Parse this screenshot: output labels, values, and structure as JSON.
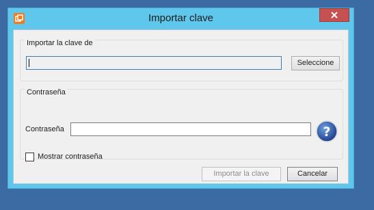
{
  "window": {
    "title": "Importar clave",
    "app_icon": "key-app-icon",
    "close_icon": "close-icon"
  },
  "import_group": {
    "legend": "Importar la clave de",
    "file_value": "",
    "select_button": "Seleccione"
  },
  "password_group": {
    "legend": "Contraseña",
    "password_label": "Contraseña",
    "password_value": "",
    "help_icon": "help-icon",
    "show_password_label": "Mostrar contraseña",
    "show_password_checked": false
  },
  "footer": {
    "import_button": "Importar la clave",
    "import_enabled": false,
    "cancel_button": "Cancelar"
  },
  "colors": {
    "desktop": "#3c6aa3",
    "titlebar": "#5fc7ec",
    "close": "#c75050",
    "client": "#f0f0f0",
    "help": "#2a4f9c"
  }
}
